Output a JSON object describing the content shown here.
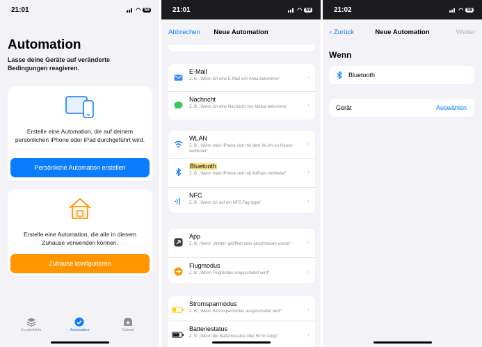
{
  "panel1": {
    "time": "21:01",
    "battery": "59",
    "title": "Automation",
    "subtitle": "Lasse deine Geräte auf veränderte Bedingungen reagieren.",
    "personal_text": "Erstelle eine Automation, die auf deinem persönlichen iPhone oder iPad durchgeführt wird.",
    "personal_button": "Persönliche Automation erstellen",
    "home_text": "Erstelle eine Automation, die alle in diesem Zuhause verwenden können.",
    "home_button": "Zuhause konfigurieren",
    "tabs": [
      {
        "label": "Kurzbefehle",
        "icon": "shortcuts-icon"
      },
      {
        "label": "Automation",
        "icon": "automation-icon"
      },
      {
        "label": "Galerie",
        "icon": "gallery-icon"
      }
    ]
  },
  "panel2": {
    "time": "21:01",
    "battery": "59",
    "nav_left": "Abbrechen",
    "nav_title": "Neue Automation",
    "groups": [
      [
        {
          "title": "E-Mail",
          "subtitle": "Z. B. „Wenn ich eine E-Mail von Anna bekomme“",
          "icon": "mail-icon"
        },
        {
          "title": "Nachricht",
          "subtitle": "Z. B. „Wenn ich eine Nachricht von Mama bekomme“",
          "icon": "message-icon"
        }
      ],
      [
        {
          "title": "WLAN",
          "subtitle": "Z. B. „Wenn mein iPhone sich mit dem WLAN zu Hause verbindet“",
          "icon": "wifi-icon"
        },
        {
          "title": "Bluetooth",
          "subtitle": "Z. B. „Wenn mein iPhone sich mit AirPods verbindet“",
          "icon": "bluetooth-icon"
        },
        {
          "title": "NFC",
          "subtitle": "Z. B. „Wenn ich auf ein NFC-Tag tippe“",
          "icon": "nfc-icon"
        }
      ],
      [
        {
          "title": "App",
          "subtitle": "Z. B. „Wenn ‚Wetter‘ geöffnet oder geschlossen wurde“",
          "icon": "app-icon"
        },
        {
          "title": "Flugmodus",
          "subtitle": "Z. B. „Wenn Flugmodus eingeschaltet wird“",
          "icon": "airplane-icon"
        }
      ],
      [
        {
          "title": "Stromsparmodus",
          "subtitle": "Z. B. „Wenn Stromsparmodus ausgeschaltet wird“",
          "icon": "low-power-icon"
        },
        {
          "title": "Batteriestatus",
          "subtitle": "Z. B. „Wenn der Batteriestatus über 50 % steigt“",
          "icon": "battery-icon"
        }
      ]
    ]
  },
  "panel3": {
    "time": "21:02",
    "battery": "59",
    "nav_left": "Zurück",
    "nav_title": "Neue Automation",
    "nav_right": "Weiter",
    "section": "Wenn",
    "trigger": "Bluetooth",
    "device_label": "Gerät",
    "device_action": "Auswählen"
  },
  "colors": {
    "accent": "#0a7cff",
    "home_orange": "#ff9500",
    "highlight": "#fde68a"
  }
}
